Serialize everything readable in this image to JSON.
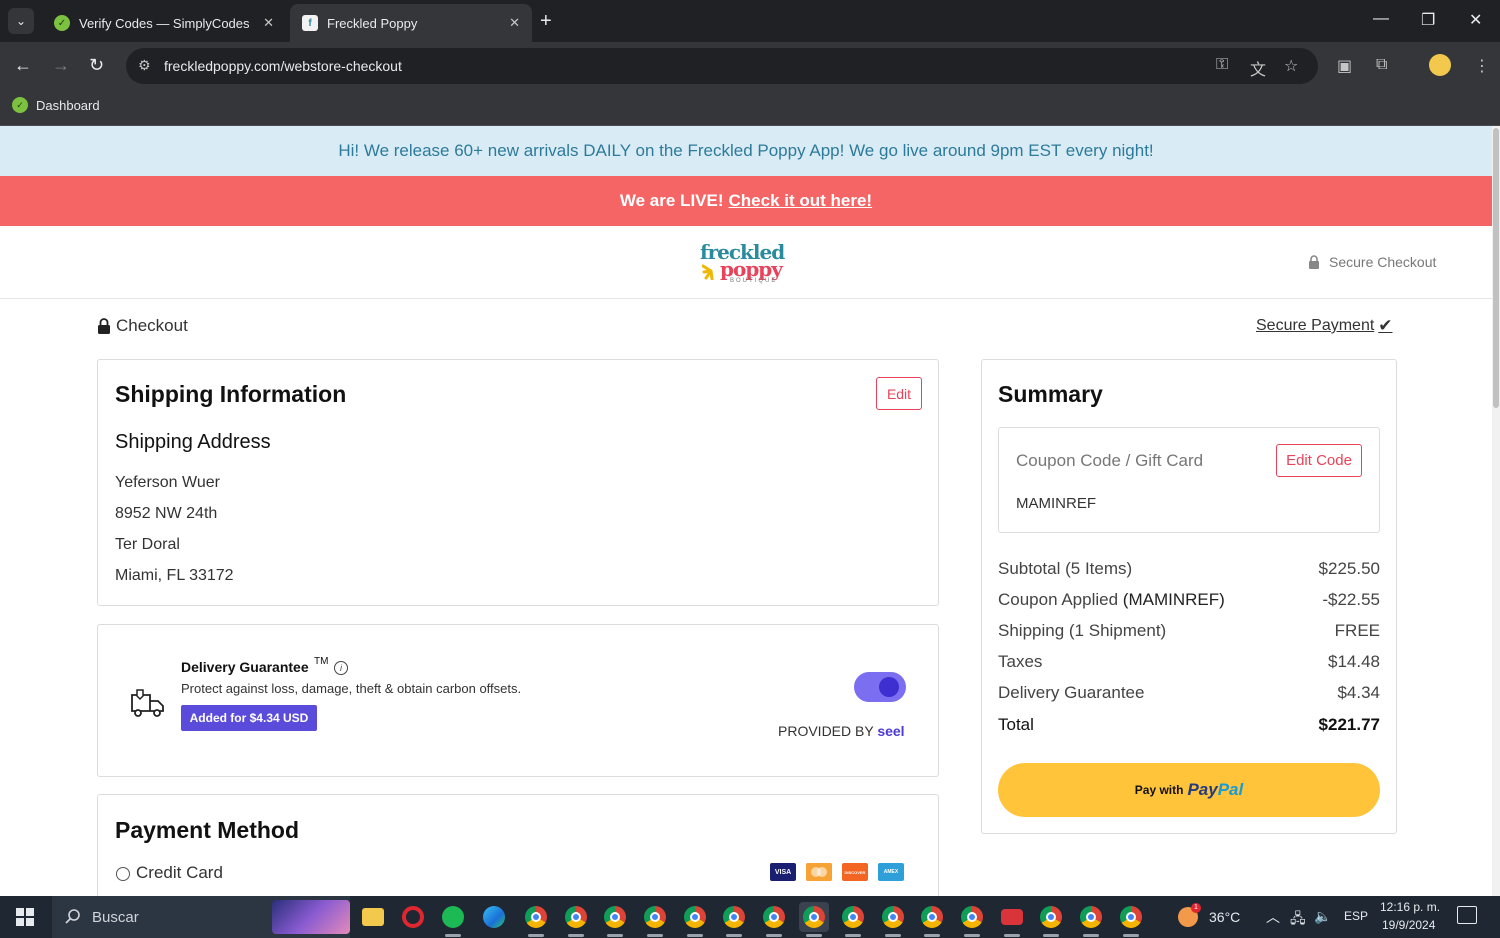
{
  "browser": {
    "tabs": [
      {
        "title": "Verify Codes — SimplyCodes",
        "active": false
      },
      {
        "title": "Freckled Poppy",
        "active": true
      }
    ],
    "url": "freckledpoppy.com/webstore-checkout",
    "bookmark": "Dashboard"
  },
  "banner": {
    "announcement": "Hi! We release 60+ new arrivals DAILY on the Freckled Poppy App! We go live around 9pm EST every night!",
    "live_text": "We are LIVE!",
    "live_link": "Check it out here!"
  },
  "header": {
    "logo_line1": "freckled",
    "logo_line2": "poppy",
    "logo_line3": "BOUTIQUE",
    "secure_checkout": "Secure Checkout"
  },
  "crumbs": {
    "checkout": "Checkout",
    "secure_payment": "Secure Payment"
  },
  "shipping": {
    "title": "Shipping Information",
    "edit": "Edit",
    "address_title": "Shipping Address",
    "lines": [
      "Yeferson Wuer",
      "8952 NW 24th",
      "Ter Doral",
      "Miami, FL 33172"
    ]
  },
  "delivery": {
    "title": "Delivery Guarantee",
    "tm": "TM",
    "info": "i",
    "description": "Protect against loss, damage, theft & obtain carbon offsets.",
    "badge": "Added for $4.34 USD",
    "enabled": true,
    "provided_by": "PROVIDED BY",
    "provider": "seel"
  },
  "payment": {
    "title": "Payment Method",
    "option": "Credit Card",
    "card_logos": [
      "VISA",
      "MC",
      "DISCOVER",
      "AMEX"
    ]
  },
  "summary": {
    "title": "Summary",
    "coupon_label": "Coupon Code / Gift Card",
    "edit_code": "Edit Code",
    "coupon_value": "MAMINREF",
    "rows": [
      {
        "label": "Subtotal (5 Items)",
        "value": "$225.50"
      },
      {
        "label": "Coupon Applied ",
        "code": "(MAMINREF)",
        "value": "-$22.55"
      },
      {
        "label": "Shipping (1 Shipment)",
        "value": "FREE"
      },
      {
        "label": "Taxes",
        "value": "$14.48"
      },
      {
        "label": "Delivery Guarantee",
        "value": "$4.34"
      }
    ],
    "total_label": "Total",
    "total_value": "$221.77",
    "paypal_prefix": "Pay with",
    "paypal_brand1": "Pay",
    "paypal_brand2": "Pal"
  },
  "taskbar": {
    "search": "Buscar",
    "weather": "36°C",
    "lang": "ESP",
    "time": "12:16 p. m.",
    "date": "19/9/2024",
    "weather_badge": "1"
  },
  "colors": {
    "accent": "#e8435a",
    "live_banner": "#f56565",
    "announce_bg": "#d9ecf5",
    "seel": "#5b4bdb",
    "paypal": "#ffc439"
  }
}
